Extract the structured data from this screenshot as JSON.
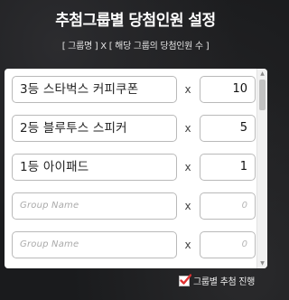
{
  "header": {
    "title": "추첨그룹별 당첨인원 설정",
    "subtitle_left": "[ 그룹명 ]",
    "subtitle_sep": "X",
    "subtitle_right": "[ 해당 그룹의 당첨인원 수 ]"
  },
  "rows": [
    {
      "name": "3등 스타벅스 커피쿠폰",
      "times": "x",
      "count": "10"
    },
    {
      "name": "2등 블루투스 스피커",
      "times": "x",
      "count": "5"
    },
    {
      "name": "1등 아이패드",
      "times": "x",
      "count": "1"
    },
    {
      "name_placeholder": "Group Name",
      "times": "x",
      "count_placeholder": "0"
    },
    {
      "name_placeholder": "Group Name",
      "times": "x",
      "count_placeholder": "0"
    }
  ],
  "footer": {
    "checkbox_checked": true,
    "label": "그룹별 추첨 진행"
  },
  "colors": {
    "check_accent": "#e03131"
  }
}
